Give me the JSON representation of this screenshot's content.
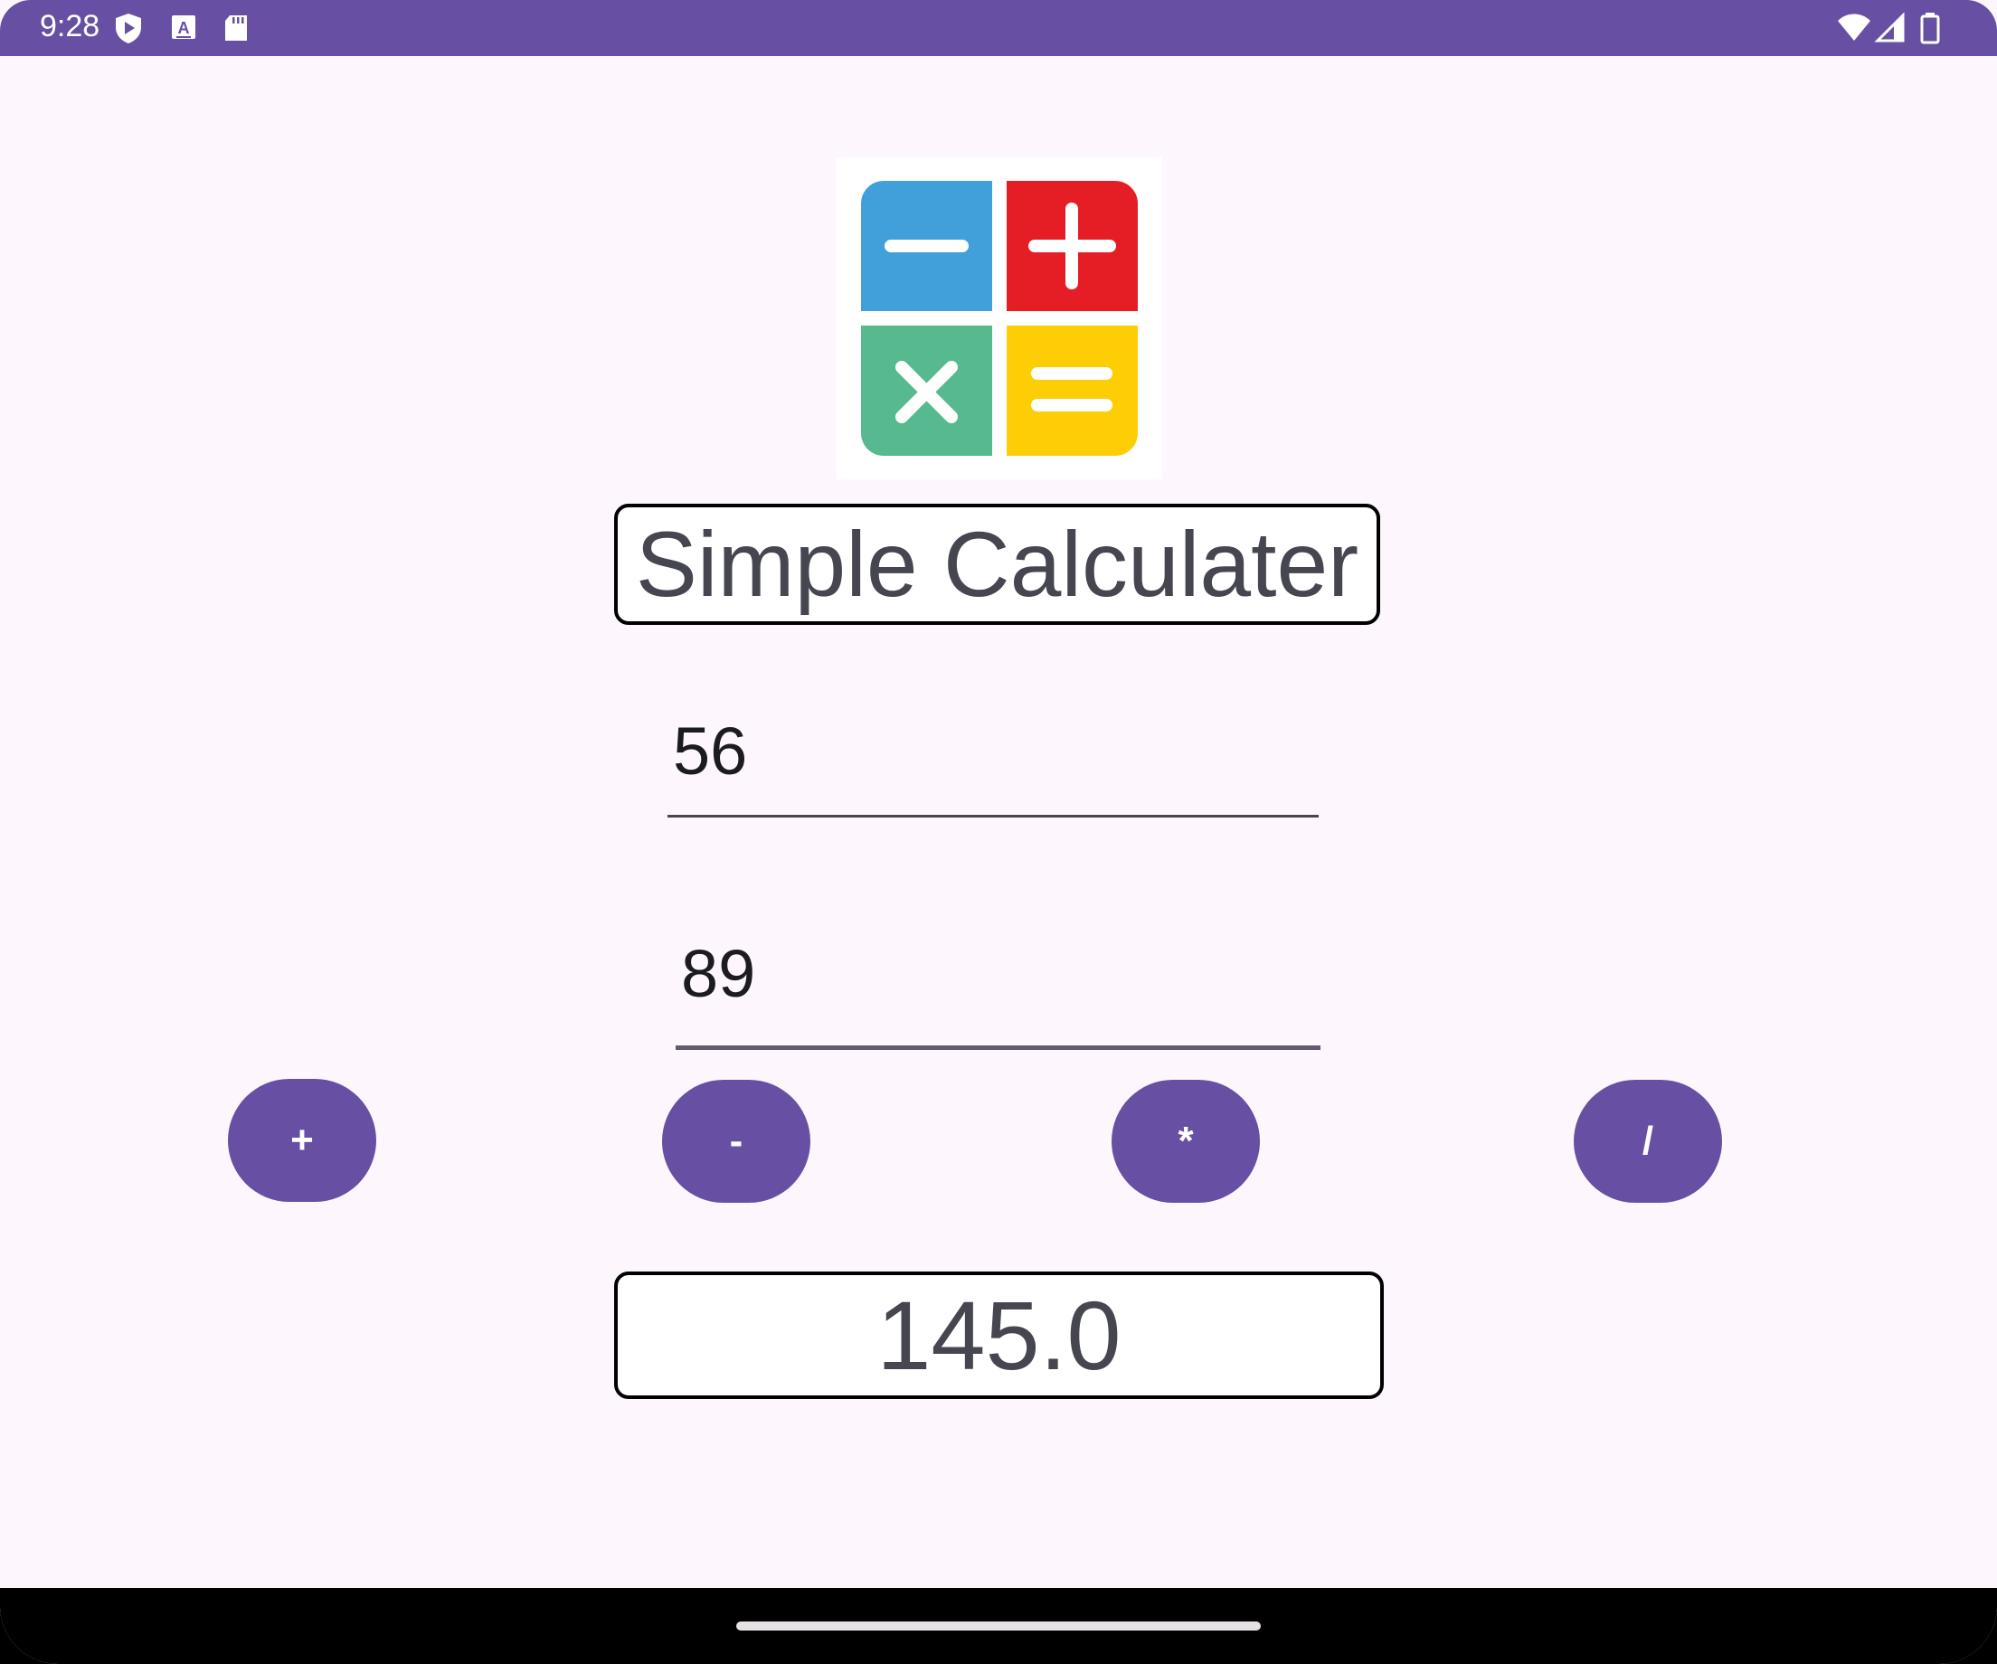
{
  "status_bar": {
    "time": "9:28",
    "left_icons": [
      "play-protect-icon",
      "keyboard-a-icon",
      "sd-card-icon"
    ],
    "right_icons": [
      "wifi-icon",
      "cellular-signal-icon",
      "battery-icon"
    ],
    "color": "#6750A4"
  },
  "app": {
    "logo_icon": "calculator-logo-icon",
    "title": "Simple Calculater",
    "first_number": "56",
    "second_number": "89",
    "operations": {
      "add": "+",
      "subtract": "-",
      "multiply": "*",
      "divide": "/"
    },
    "result": "145.0",
    "accent_color": "#6750A4",
    "background_color": "#FDF7FD"
  },
  "nav_bar": {
    "handle_icon": "gesture-handle"
  }
}
